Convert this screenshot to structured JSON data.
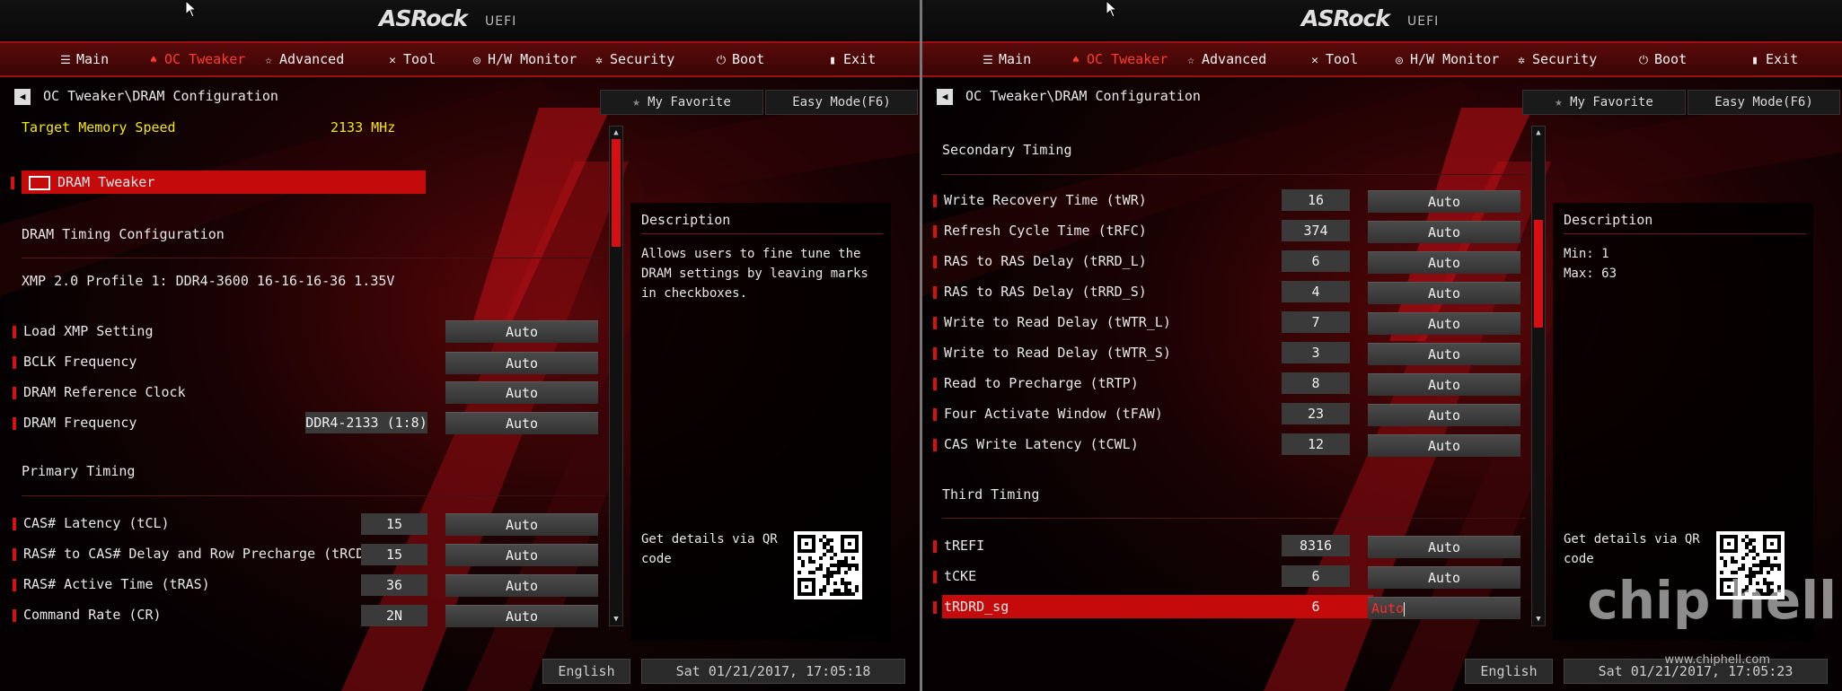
{
  "brand": {
    "logo": "ASRock",
    "subtitle": "UEFI"
  },
  "nav": {
    "tabs": [
      {
        "label": "Main",
        "icon": "list-icon"
      },
      {
        "label": "OC Tweaker",
        "icon": "flame-icon",
        "active": true
      },
      {
        "label": "Advanced",
        "icon": "star-icon"
      },
      {
        "label": "Tool",
        "icon": "wrench-icon"
      },
      {
        "label": "H/W Monitor",
        "icon": "monitor-icon"
      },
      {
        "label": "Security",
        "icon": "shield-icon"
      },
      {
        "label": "Boot",
        "icon": "power-icon"
      },
      {
        "label": "Exit",
        "icon": "exit-icon"
      }
    ]
  },
  "common": {
    "breadcrumb": "OC Tweaker\\DRAM Configuration",
    "favorite_label": "My Favorite",
    "easy_mode_label": "Easy Mode(F6)",
    "description_title": "Description",
    "qr_text": "Get details via QR code",
    "language": "English"
  },
  "left": {
    "target_label": "Target Memory Speed",
    "target_value": "2133 MHz",
    "dram_tweaker": "DRAM Tweaker",
    "timing_config": "DRAM Timing Configuration",
    "xmp_profile": "XMP 2.0 Profile 1: DDR4-3600 16-16-16-36 1.35V",
    "settings": [
      {
        "label": "Load XMP Setting",
        "value": "Auto"
      },
      {
        "label": "BCLK Frequency",
        "value": "Auto"
      },
      {
        "label": "DRAM Reference Clock",
        "value": "Auto"
      },
      {
        "label": "DRAM Frequency",
        "current": "DDR4-2133 (1:8)",
        "value": "Auto"
      }
    ],
    "primary_title": "Primary Timing",
    "primary": [
      {
        "label": "CAS# Latency (tCL)",
        "current": "15",
        "value": "Auto"
      },
      {
        "label": "RAS# to CAS# Delay and Row Precharge (tRCDtRP)",
        "current": "15",
        "value": "Auto"
      },
      {
        "label": "RAS# Active Time (tRAS)",
        "current": "36",
        "value": "Auto"
      },
      {
        "label": "Command Rate (CR)",
        "current": "2N",
        "value": "Auto"
      }
    ],
    "description": "Allows users to fine tune the DRAM settings by leaving marks in checkboxes.",
    "datetime": "Sat 01/21/2017, 17:05:18",
    "scroll_position": 0.0
  },
  "right": {
    "secondary_title": "Secondary Timing",
    "secondary": [
      {
        "label": "Write Recovery Time (tWR)",
        "current": "16",
        "value": "Auto"
      },
      {
        "label": "Refresh Cycle Time (tRFC)",
        "current": "374",
        "value": "Auto"
      },
      {
        "label": "RAS to RAS Delay (tRRD_L)",
        "current": "6",
        "value": "Auto"
      },
      {
        "label": "RAS to RAS Delay (tRRD_S)",
        "current": "4",
        "value": "Auto"
      },
      {
        "label": "Write to Read Delay (tWTR_L)",
        "current": "7",
        "value": "Auto"
      },
      {
        "label": "Write to Read Delay (tWTR_S)",
        "current": "3",
        "value": "Auto"
      },
      {
        "label": "Read to Precharge (tRTP)",
        "current": "8",
        "value": "Auto"
      },
      {
        "label": "Four Activate Window (tFAW)",
        "current": "23",
        "value": "Auto"
      },
      {
        "label": "CAS Write Latency (tCWL)",
        "current": "12",
        "value": "Auto"
      }
    ],
    "third_title": "Third Timing",
    "third": [
      {
        "label": "tREFI",
        "current": "8316",
        "value": "Auto"
      },
      {
        "label": "tCKE",
        "current": "6",
        "value": "Auto"
      },
      {
        "label": "tRDRD_sg",
        "current": "6",
        "value": "Auto",
        "selected": true
      }
    ],
    "description_min": "Min: 1",
    "description_max": "Max: 63",
    "datetime": "Sat 01/21/2017, 17:05:23",
    "watermark_logo": "chip hell",
    "watermark_url": "www.chiphell.com",
    "scroll_position": 0.22
  }
}
